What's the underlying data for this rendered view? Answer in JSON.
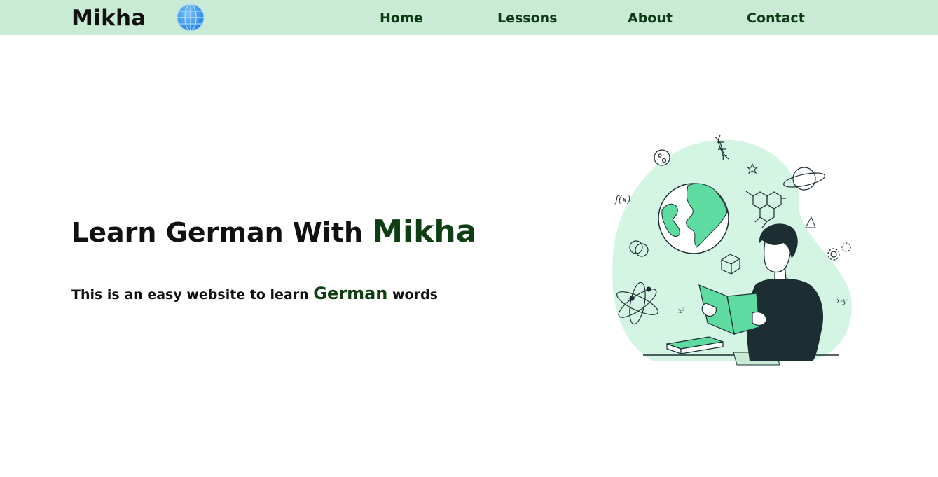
{
  "header": {
    "brand": "Mikha",
    "logo_icon": "globe-icon",
    "nav": [
      {
        "label": "Home"
      },
      {
        "label": "Lessons"
      },
      {
        "label": "About"
      },
      {
        "label": "Contact"
      }
    ]
  },
  "hero": {
    "title_prefix": "Learn German With ",
    "title_accent": "Mikha",
    "subtitle_prefix": "This is an easy website to learn ",
    "subtitle_accent": "German",
    "subtitle_suffix": " words",
    "illustration": "student-reading-book-illustration"
  },
  "colors": {
    "header_bg": "#c9ead5",
    "nav_text": "#0b3b14",
    "accent_green": "#0e3e12",
    "illustration_green": "#5ddba0",
    "illustration_blob": "#d5f5e4",
    "illustration_dark": "#1d2e33"
  }
}
